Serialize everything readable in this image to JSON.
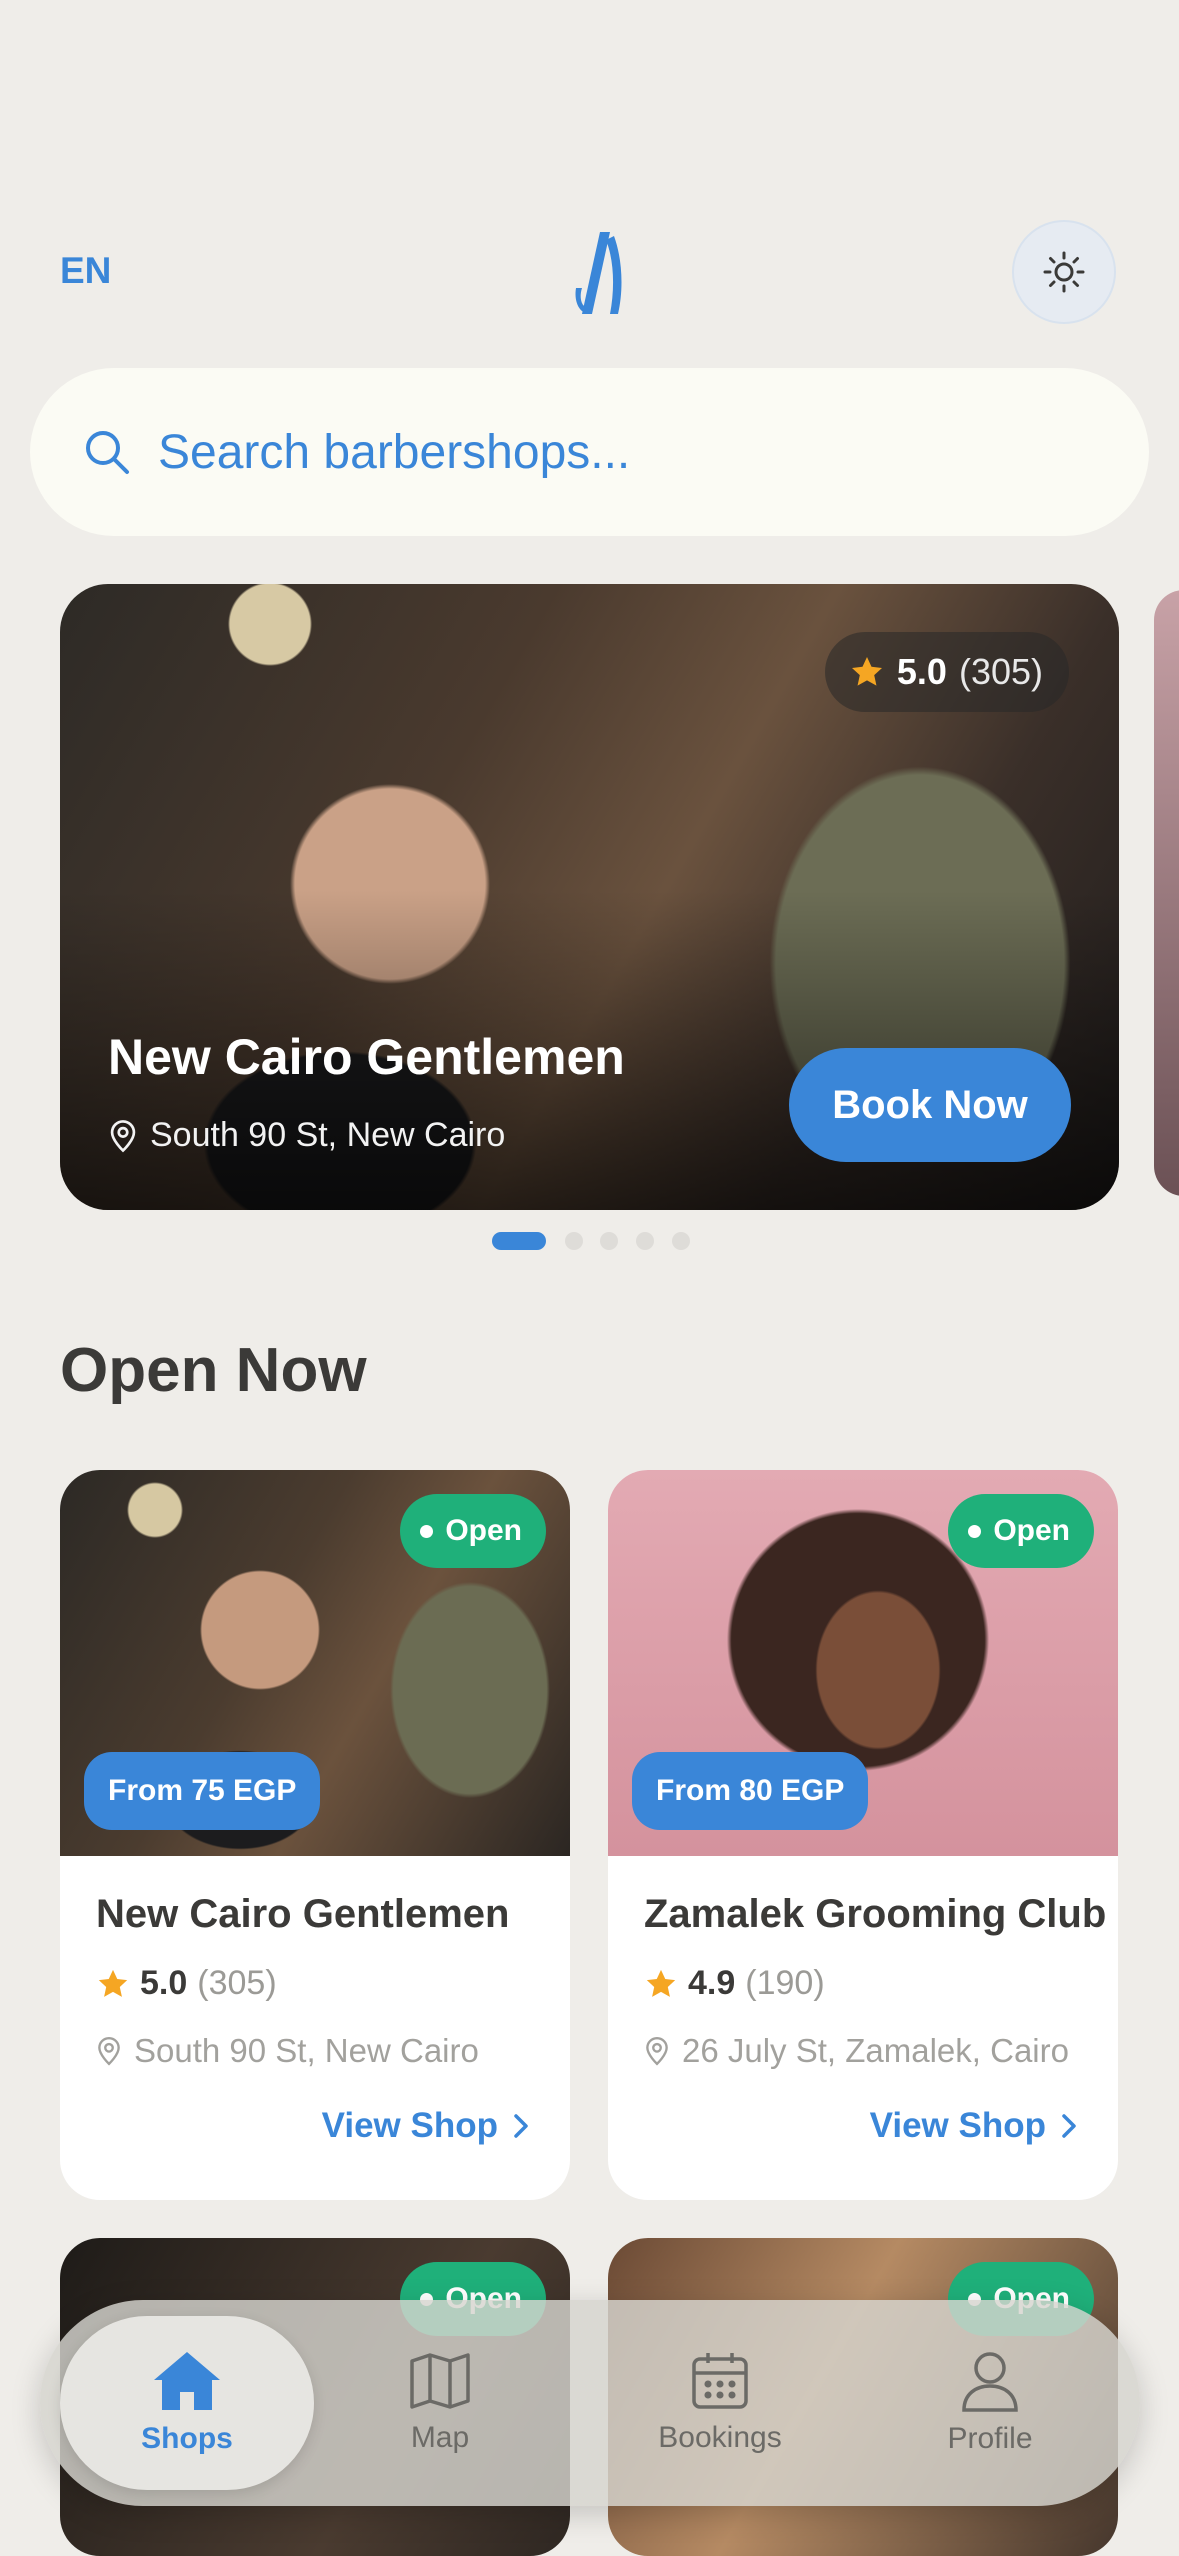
{
  "header": {
    "language": "EN",
    "logo_icon": "app-logo-icon",
    "theme_icon": "sun-icon"
  },
  "search": {
    "placeholder": "Search barbershops...",
    "icon": "search-icon"
  },
  "featured": {
    "title": "New Cairo Gentlemen",
    "rating": "5.0",
    "reviews": "(305)",
    "address": "South 90 St, New Cairo",
    "book_label": "Book Now",
    "carousel": {
      "pages": 5,
      "active": 1
    }
  },
  "open_now": {
    "title": "Open Now",
    "shops": [
      {
        "name": "New Cairo Gentlemen",
        "status": "Open",
        "price": "From 75 EGP",
        "rating": "5.0",
        "reviews": "(305)",
        "address": "South 90 St, New Cairo",
        "link": "View Shop"
      },
      {
        "name": "Zamalek Grooming Club",
        "status": "Open",
        "price": "From 80 EGP",
        "rating": "4.9",
        "reviews": "(190)",
        "address": "26 July St, Zamalek, Cairo",
        "link": "View Shop"
      },
      {
        "status": "Open"
      },
      {
        "status": "Open"
      }
    ]
  },
  "nav": {
    "items": [
      {
        "label": "Shops",
        "icon": "home-icon",
        "active": true
      },
      {
        "label": "Map",
        "icon": "map-icon"
      },
      {
        "label": "Bookings",
        "icon": "calendar-icon"
      },
      {
        "label": "Profile",
        "icon": "user-icon"
      }
    ]
  },
  "colors": {
    "accent": "#3a86d8",
    "open": "#1fb07a",
    "star": "#f5a623",
    "background": "#efede9"
  }
}
